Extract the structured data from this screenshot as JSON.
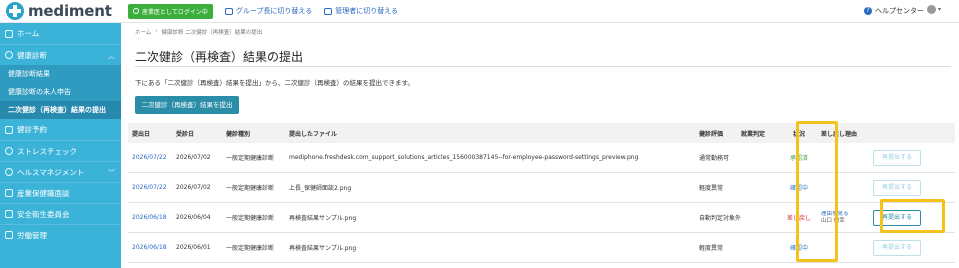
{
  "header": {
    "logo_text": "mediment",
    "role_badge": "産業医としてログイン中",
    "switch_group": "グループ長に切り替える",
    "switch_admin": "管理者に切り替える",
    "help": "ヘルプセンター"
  },
  "sidebar": {
    "items": [
      {
        "label": "ホーム"
      },
      {
        "label": "健康診断"
      },
      {
        "label": "健康診断結果"
      },
      {
        "label": "健康診断の未人申告"
      },
      {
        "label": "二次健診（再検査）結果の提出"
      },
      {
        "label": "健診予約"
      },
      {
        "label": "ストレスチェック"
      },
      {
        "label": "ヘルスマネジメント"
      },
      {
        "label": "産業保健職面談"
      },
      {
        "label": "安全衛生委員会"
      },
      {
        "label": "労働管理"
      }
    ]
  },
  "breadcrumb": [
    "ホーム",
    "›",
    "健康診断 二次健診（再検査）結果の提出"
  ],
  "page": {
    "title": "二次健診（再検査）結果の提出",
    "description": "下にある「二次健診（再検査）結果を提出」から、二次健診（再検査）の結果を提出できます。",
    "submit_button": "二次健診（再検査）結果を提出"
  },
  "table": {
    "headers": [
      "提出日",
      "受診日",
      "健診種別",
      "提出したファイル",
      "健診評価",
      "就業判定",
      "状況",
      "差し戻し理由",
      ""
    ],
    "rows": [
      {
        "submitted": "2026/07/22",
        "received": "2026/07/02",
        "type": "一般定期健康診断",
        "file": "mediphone.freshdesk.com_support_solutions_articles_156000387145--for-employee-password-settings_preview.png",
        "eval": "通常勤務可",
        "emp": "",
        "status": "承認済",
        "reason_link": "",
        "reason_by": "",
        "action": "再提出する"
      },
      {
        "submitted": "2026/07/22",
        "received": "2026/07/02",
        "type": "一般定期健康診断",
        "file": "上長_保健師面談2.png",
        "eval": "軽度異常",
        "emp": "",
        "status": "確認中",
        "reason_link": "",
        "reason_by": "",
        "action": "再提出する"
      },
      {
        "submitted": "2026/06/18",
        "received": "2026/06/04",
        "type": "一般定期健康診断",
        "file": "再検査結果サンプル.png",
        "eval": "自動判定対象外",
        "emp": "",
        "status": "差し戻し",
        "reason_link": "理由を見る",
        "reason_by": "山口 優幸",
        "action": "再提出する"
      },
      {
        "submitted": "2026/06/18",
        "received": "2026/06/01",
        "type": "一般定期健康診断",
        "file": "再検査結果サンプル.png",
        "eval": "軽度異常",
        "emp": "",
        "status": "確認中",
        "reason_link": "",
        "reason_by": "",
        "action": "再提出する"
      }
    ]
  },
  "colors": {
    "sidebar": "#3bb3d8",
    "primary_button": "#2b8ea8",
    "highlight": "#f5c21b",
    "status_approved": "#3c9a3c",
    "status_checking": "#2a7ac0",
    "status_returned": "#d93030"
  }
}
